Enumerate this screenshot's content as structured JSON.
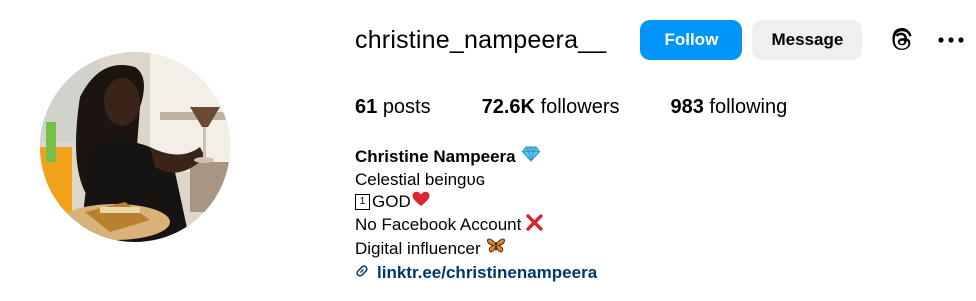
{
  "profile": {
    "username": "christine_nampeera__",
    "display_name": "Christine Nampeera",
    "verified_emoji": "diamond-icon"
  },
  "actions": {
    "follow_label": "Follow",
    "message_label": "Message",
    "threads_icon": "threads-icon",
    "more_icon": "more-options-icon"
  },
  "stats": {
    "posts_count": "61",
    "posts_label": "posts",
    "followers_count": "72.6K",
    "followers_label": "followers",
    "following_count": "983",
    "following_label": "following"
  },
  "bio": {
    "line1": "Celestial beingᴜɢ",
    "line2_key": "1",
    "line2_text": "GOD",
    "line3": "No Facebook Account",
    "line4": "Digital influencer",
    "link": "linktr.ee/christinenampeera"
  },
  "colors": {
    "follow_bg": "#0095f6",
    "message_bg": "#efefef",
    "link": "#00376b"
  }
}
